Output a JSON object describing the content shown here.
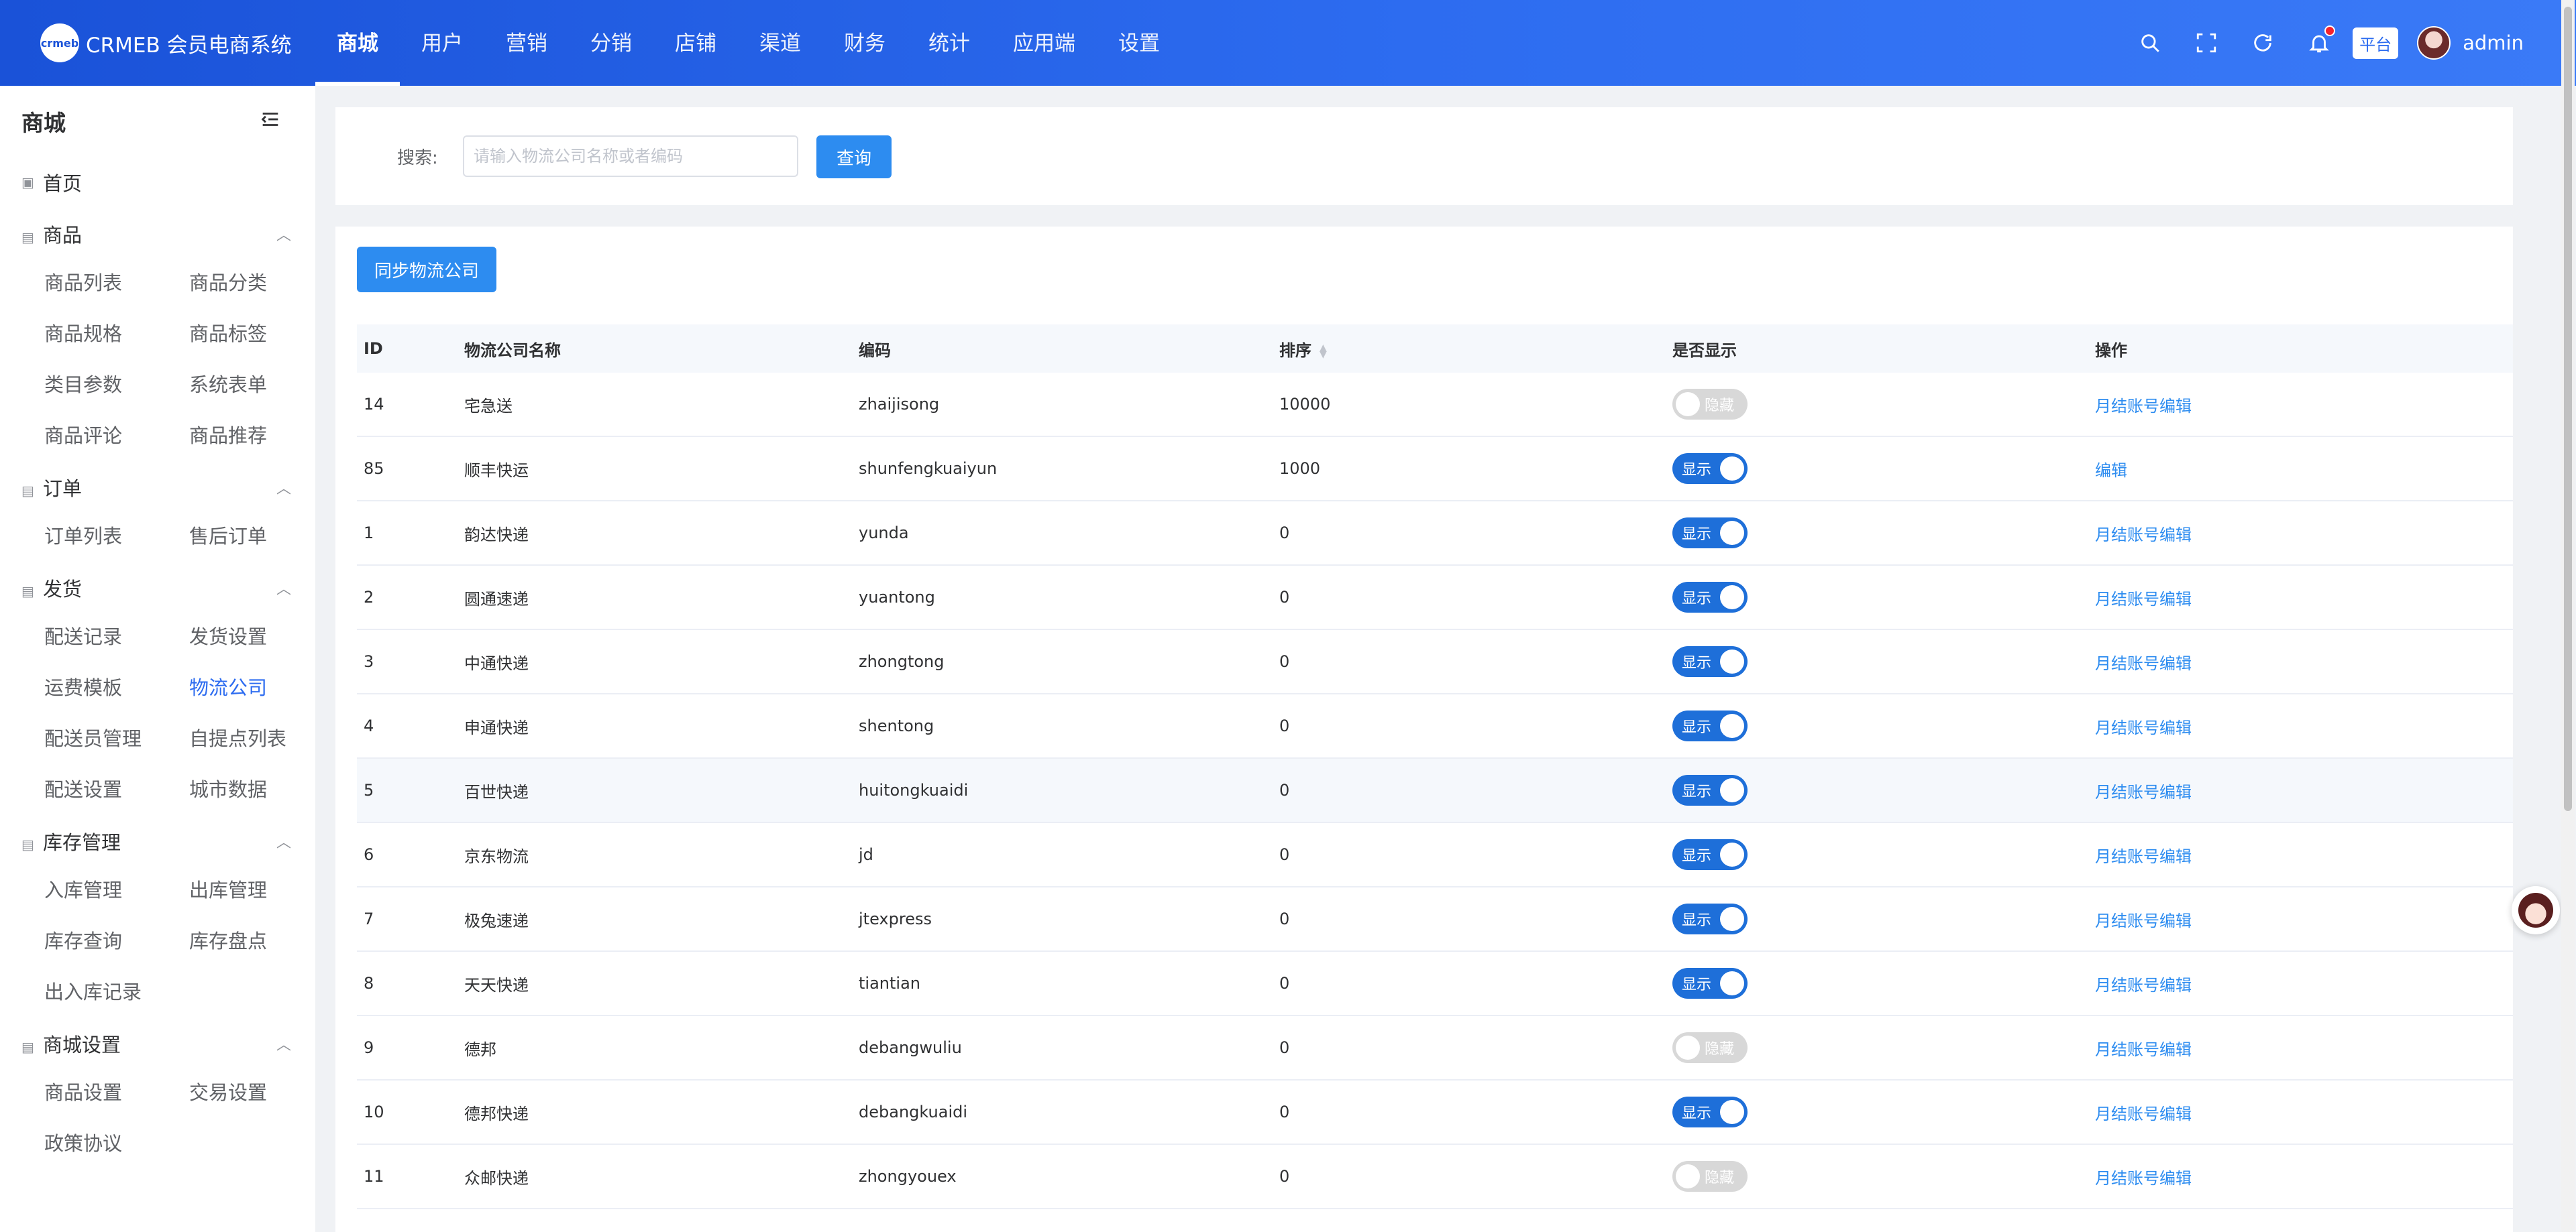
{
  "header": {
    "brand_logo_text": "crmeb",
    "brand_name": "CRMEB 会员电商系统",
    "nav": [
      "商城",
      "用户",
      "营销",
      "分销",
      "店铺",
      "渠道",
      "财务",
      "统计",
      "应用端",
      "设置"
    ],
    "active_nav": "商城",
    "platform_tag": "平台",
    "username": "admin",
    "tool_icons": [
      "search-icon",
      "fullscreen-icon",
      "refresh-icon",
      "bell-icon"
    ]
  },
  "sidebar": {
    "title": "商城",
    "home": "首页",
    "groups": [
      {
        "title": "商品",
        "items": [
          "商品列表",
          "商品分类",
          "商品规格",
          "商品标签",
          "类目参数",
          "系统表单",
          "商品评论",
          "商品推荐"
        ]
      },
      {
        "title": "订单",
        "items": [
          "订单列表",
          "售后订单"
        ]
      },
      {
        "title": "发货",
        "items": [
          "配送记录",
          "发货设置",
          "运费模板",
          "物流公司",
          "配送员管理",
          "自提点列表",
          "配送设置",
          "城市数据"
        ]
      },
      {
        "title": "库存管理",
        "items": [
          "入库管理",
          "出库管理",
          "库存查询",
          "库存盘点",
          "出入库记录"
        ]
      },
      {
        "title": "商城设置",
        "items": [
          "商品设置",
          "交易设置",
          "政策协议"
        ]
      }
    ],
    "active_item": "物流公司"
  },
  "search": {
    "label": "搜索:",
    "placeholder": "请输入物流公司名称或者编码",
    "value": "",
    "button": "查询"
  },
  "toolbar": {
    "sync_button": "同步物流公司"
  },
  "table": {
    "headers": {
      "id": "ID",
      "name": "物流公司名称",
      "code": "编码",
      "sort": "排序",
      "show": "是否显示",
      "op": "操作"
    },
    "switch_on_label": "显示",
    "switch_off_label": "隐藏",
    "rows": [
      {
        "id": "14",
        "name": "宅急送",
        "code": "zhaijisong",
        "sort": "10000",
        "show": false,
        "op": "月结账号编辑"
      },
      {
        "id": "85",
        "name": "顺丰快运",
        "code": "shunfengkuaiyun",
        "sort": "1000",
        "show": true,
        "op": "编辑"
      },
      {
        "id": "1",
        "name": "韵达快递",
        "code": "yunda",
        "sort": "0",
        "show": true,
        "op": "月结账号编辑"
      },
      {
        "id": "2",
        "name": "圆通速递",
        "code": "yuantong",
        "sort": "0",
        "show": true,
        "op": "月结账号编辑"
      },
      {
        "id": "3",
        "name": "中通快递",
        "code": "zhongtong",
        "sort": "0",
        "show": true,
        "op": "月结账号编辑"
      },
      {
        "id": "4",
        "name": "申通快递",
        "code": "shentong",
        "sort": "0",
        "show": true,
        "op": "月结账号编辑"
      },
      {
        "id": "5",
        "name": "百世快递",
        "code": "huitongkuaidi",
        "sort": "0",
        "show": true,
        "op": "月结账号编辑"
      },
      {
        "id": "6",
        "name": "京东物流",
        "code": "jd",
        "sort": "0",
        "show": true,
        "op": "月结账号编辑"
      },
      {
        "id": "7",
        "name": "极兔速递",
        "code": "jtexpress",
        "sort": "0",
        "show": true,
        "op": "月结账号编辑"
      },
      {
        "id": "8",
        "name": "天天快递",
        "code": "tiantian",
        "sort": "0",
        "show": true,
        "op": "月结账号编辑"
      },
      {
        "id": "9",
        "name": "德邦",
        "code": "debangwuliu",
        "sort": "0",
        "show": false,
        "op": "月结账号编辑"
      },
      {
        "id": "10",
        "name": "德邦快递",
        "code": "debangkuaidi",
        "sort": "0",
        "show": true,
        "op": "月结账号编辑"
      },
      {
        "id": "11",
        "name": "众邮快递",
        "code": "zhongyouex",
        "sort": "0",
        "show": false,
        "op": "月结账号编辑"
      }
    ],
    "hover_row": "5"
  },
  "colors": {
    "primary": "#2d8cf0",
    "header": "#1a52d8",
    "switch_on": "#1e6fd9",
    "switch_off": "#d8d8d8"
  }
}
